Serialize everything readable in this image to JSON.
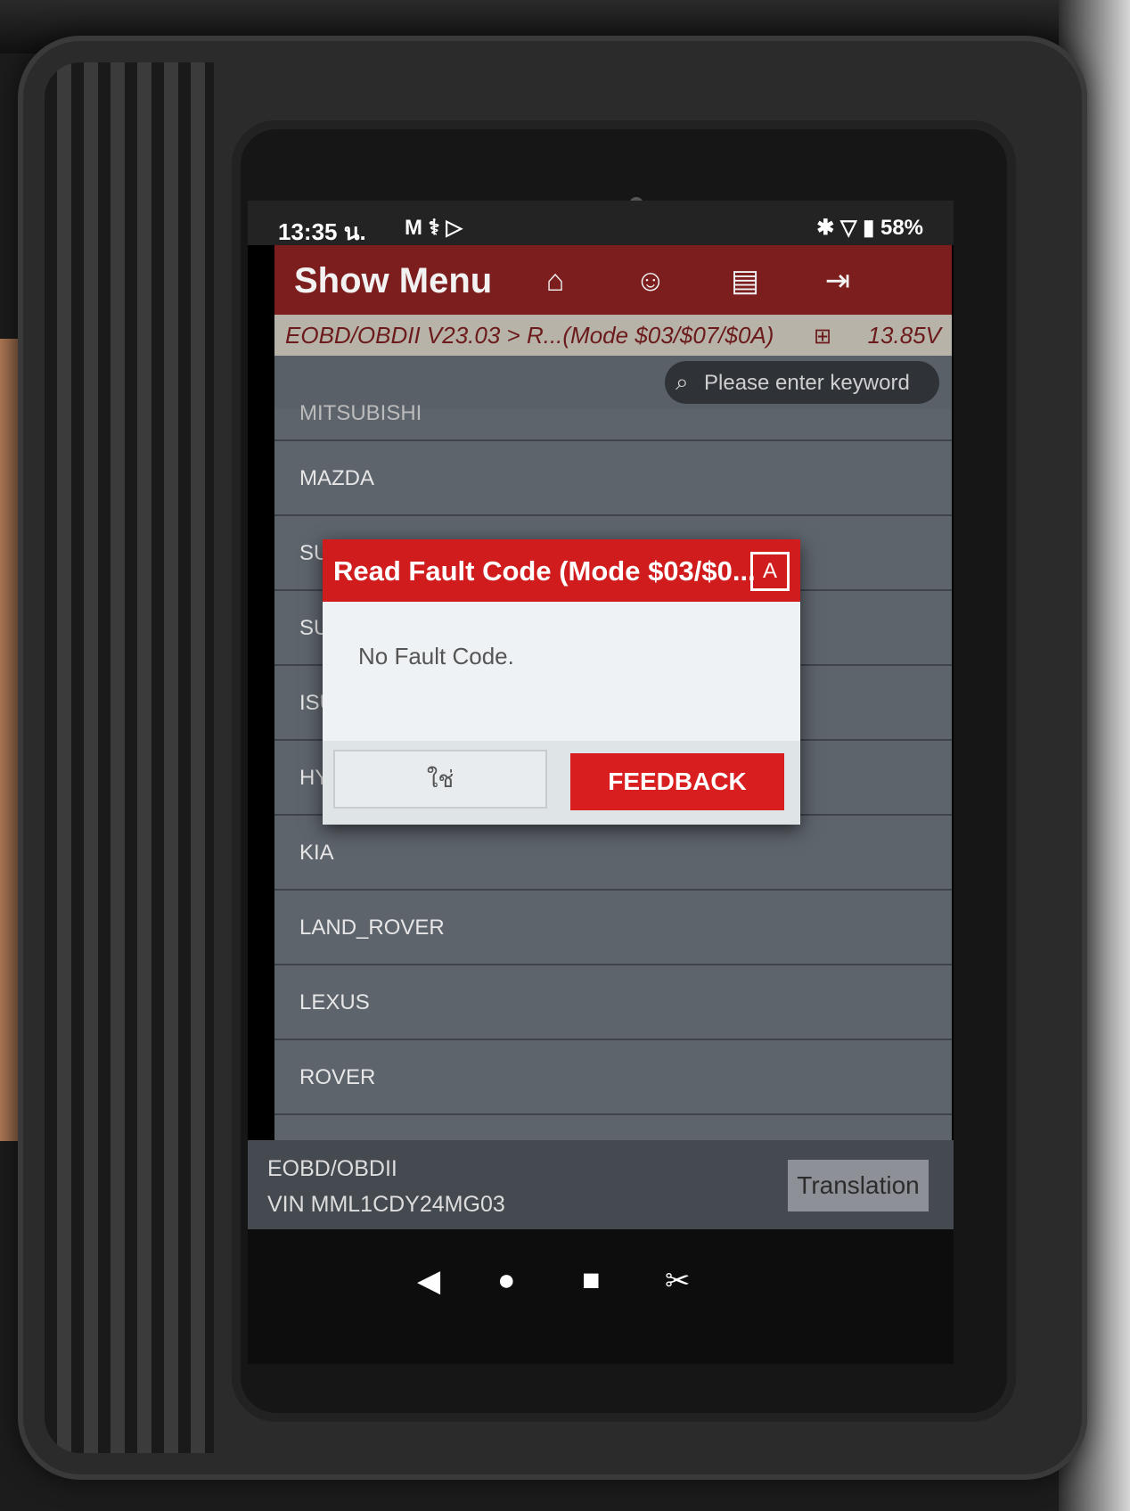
{
  "status": {
    "time": "13:35 น.",
    "icons_left": "M ⚕ ▷",
    "icons_right": "✱ ▽ ▮ 58%"
  },
  "header": {
    "title": "Show Menu",
    "icons": [
      "home-icon",
      "user-icon",
      "print-icon",
      "exit-icon"
    ]
  },
  "crumb": {
    "path": "EOBD/OBDII V23.03 > R...(Mode $03/$07/$0A)",
    "voltage": "13.85V"
  },
  "search": {
    "placeholder": "Please enter keyword"
  },
  "list": {
    "partial": "MITSUBISHI",
    "items": [
      "MAZDA",
      "SUBARU",
      "SUZUKI",
      "ISUZU",
      "HYUNDAI",
      "KIA",
      "LAND_ROVER",
      "LEXUS",
      "ROVER"
    ]
  },
  "footer": {
    "system": "EOBD/OBDII",
    "vin": "VIN MML1CDY24MG03",
    "translation": "Translation"
  },
  "dialog": {
    "title": "Read Fault Code (Mode $03/$0...",
    "message": "No Fault Code.",
    "yes_label": "ใช่",
    "feedback_label": "FEEDBACK"
  },
  "colors": {
    "header": "#7c1e1e",
    "dialog_header": "#d01c1c",
    "feedback": "#d81e1e",
    "list_bg": "#5d646c"
  }
}
